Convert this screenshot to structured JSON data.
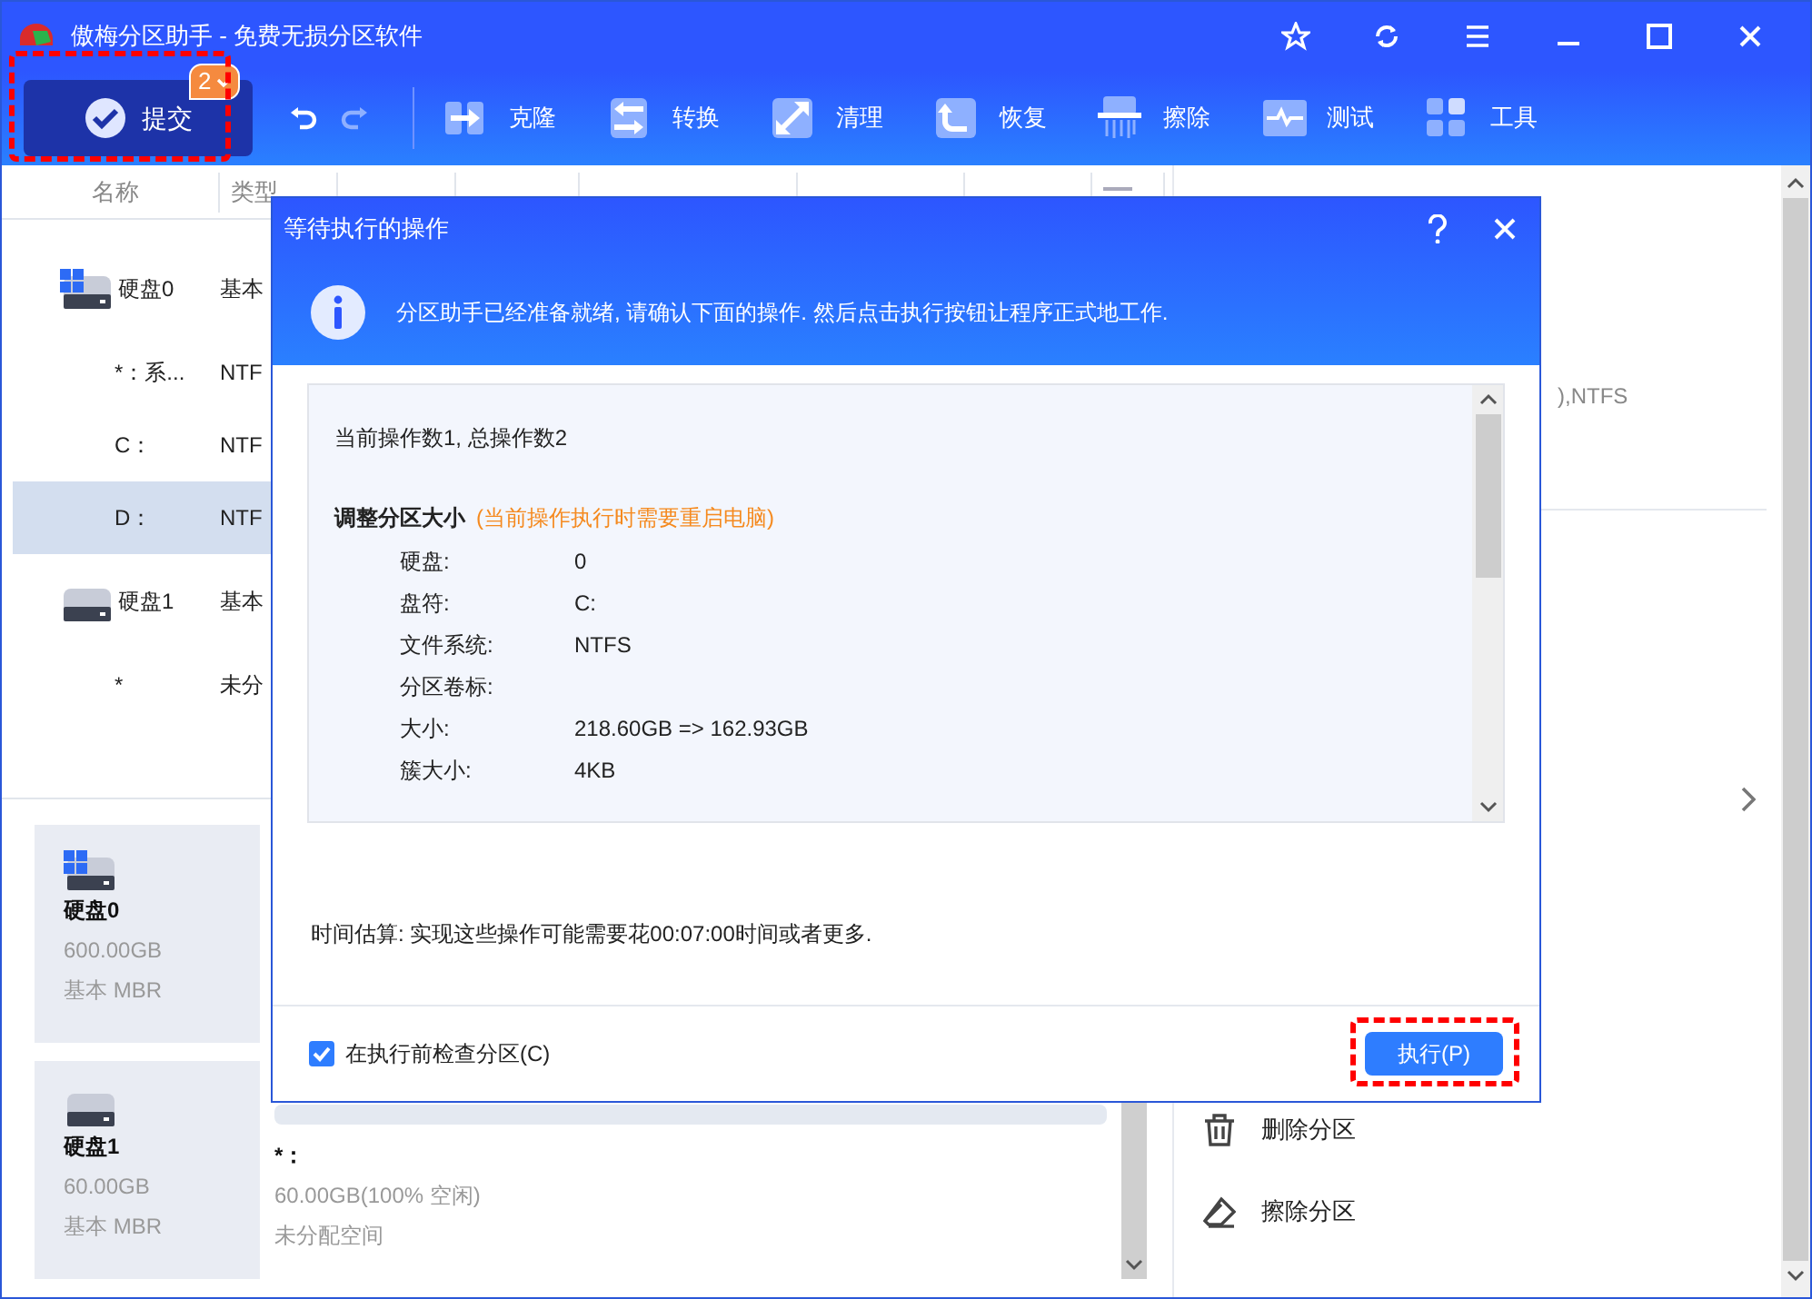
{
  "window": {
    "title": "傲梅分区助手 - 免费无损分区软件"
  },
  "toolbar": {
    "submit": {
      "label": "提交",
      "count": "2",
      "highlighted": true
    },
    "undo": {
      "disabled": false
    },
    "redo": {
      "disabled": true
    },
    "tools": [
      {
        "label": "克隆"
      },
      {
        "label": "转换"
      },
      {
        "label": "清理"
      },
      {
        "label": "恢复"
      },
      {
        "label": "擦除"
      },
      {
        "label": "测试"
      },
      {
        "label": "工具"
      }
    ]
  },
  "table": {
    "columns": [
      "名称",
      "类型"
    ],
    "rows": [
      {
        "kind": "disk",
        "name": "硬盘0",
        "column_2": "基本",
        "system": true,
        "selected": false
      },
      {
        "kind": "partition",
        "name": "*：系...",
        "column_2": "NTF",
        "selected": false
      },
      {
        "kind": "partition",
        "name": "C：",
        "column_2": "NTF",
        "selected": false
      },
      {
        "kind": "partition",
        "name": "D：",
        "column_2": "NTF",
        "selected": true
      },
      {
        "kind": "disk",
        "name": "硬盘1",
        "column_2": "基本",
        "system": false,
        "selected": false
      },
      {
        "kind": "partition",
        "name": "*",
        "column_2": "未分",
        "selected": false
      }
    ]
  },
  "disks": [
    {
      "name": "硬盘0",
      "size": "600.00GB",
      "type": "基本 MBR",
      "system": true
    },
    {
      "name": "硬盘1",
      "size": "60.00GB",
      "type": "基本 MBR",
      "system": false,
      "partitions": [
        {
          "name": "*：",
          "detail": "60.00GB(100% 空闲)",
          "type": "未分配空间"
        }
      ]
    }
  ],
  "right_panel": {
    "partition_info": "),NTFS",
    "actions": [
      {
        "label": "删除分区"
      },
      {
        "label": "擦除分区"
      }
    ]
  },
  "dialog": {
    "title": "等待执行的操作",
    "message": "分区助手已经准备就绪, 请确认下面的操作. 然后点击执行按钮让程序正式地工作.",
    "summary": "当前操作数1, 总操作数2",
    "operation": {
      "title": "调整分区大小",
      "note": "(当前操作执行时需要重启电脑)",
      "fields": [
        {
          "label": "硬盘:",
          "value": "0"
        },
        {
          "label": "盘符:",
          "value": "C:"
        },
        {
          "label": "文件系统:",
          "value": "NTFS"
        },
        {
          "label": "分区卷标:"
        },
        {
          "label": "大小:",
          "value": "218.60GB => 162.93GB"
        },
        {
          "label": "簇大小:",
          "value": "4KB"
        }
      ]
    },
    "estimate": "时间估算: 实现这些操作可能需要花00:07:00时间或者更多.",
    "check": {
      "label": "在执行前检查分区(C)",
      "checked": true
    },
    "execute": {
      "label": "执行(P)",
      "highlighted": true
    }
  }
}
